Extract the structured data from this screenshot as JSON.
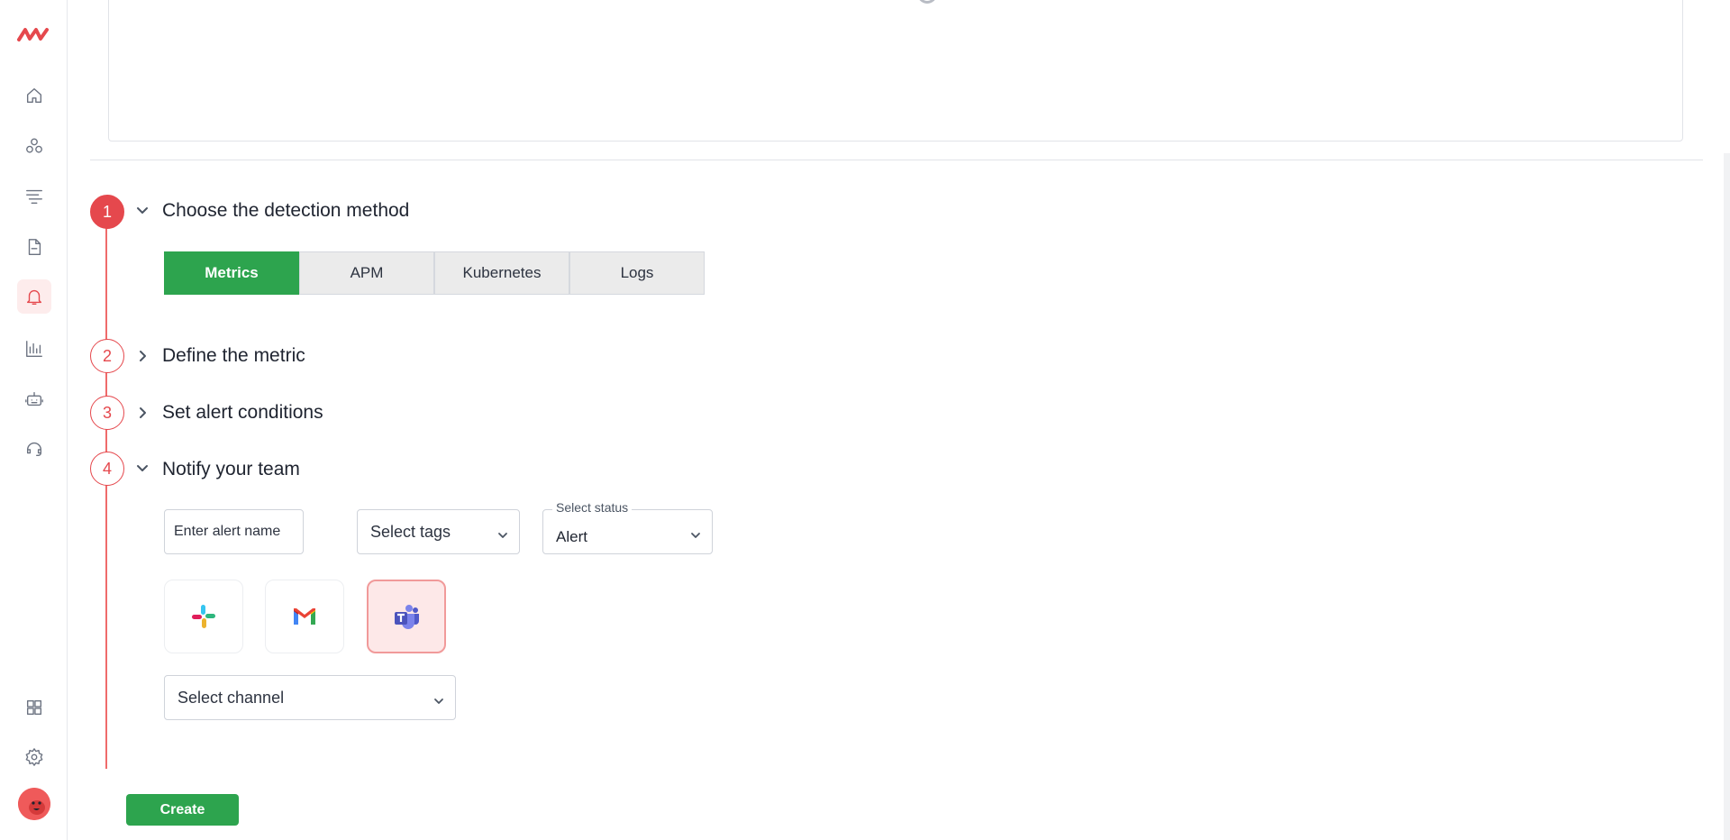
{
  "sidebar": {
    "logo_icon": "middleware-logo-icon",
    "items": [
      {
        "name": "home",
        "icon": "home-icon"
      },
      {
        "name": "infrastructure",
        "icon": "circles-icon"
      },
      {
        "name": "logs",
        "icon": "list-filter-icon"
      },
      {
        "name": "reports",
        "icon": "document-icon"
      },
      {
        "name": "alerts",
        "icon": "bell-icon",
        "active": true
      },
      {
        "name": "dashboards",
        "icon": "bar-chart-icon"
      },
      {
        "name": "ai",
        "icon": "robot-icon"
      },
      {
        "name": "support",
        "icon": "headset-icon"
      }
    ],
    "bottom": [
      {
        "name": "apps",
        "icon": "grid-icon"
      },
      {
        "name": "settings",
        "icon": "gear-icon"
      }
    ]
  },
  "steps": [
    {
      "number": "1",
      "title": "Choose the detection method",
      "expanded": true,
      "filled": true
    },
    {
      "number": "2",
      "title": "Define the metric",
      "expanded": false
    },
    {
      "number": "3",
      "title": "Set alert conditions",
      "expanded": false
    },
    {
      "number": "4",
      "title": "Notify your team",
      "expanded": true
    }
  ],
  "detection_tabs": {
    "metrics": "Metrics",
    "apm": "APM",
    "kubernetes": "Kubernetes",
    "logs": "Logs",
    "selected": "Metrics"
  },
  "notify": {
    "alert_name_placeholder": "Enter alert name",
    "tags_placeholder": "Select tags",
    "status_label": "Select status",
    "status_value": "Alert",
    "channels": [
      {
        "name": "slack",
        "icon": "slack-icon"
      },
      {
        "name": "gmail",
        "icon": "gmail-icon"
      },
      {
        "name": "microsoft-teams",
        "icon": "teams-icon",
        "selected": true
      }
    ],
    "channel_placeholder": "Select channel"
  },
  "actions": {
    "create_label": "Create"
  },
  "colors": {
    "accent": "#e5484d",
    "primary_green": "#2da44e"
  }
}
